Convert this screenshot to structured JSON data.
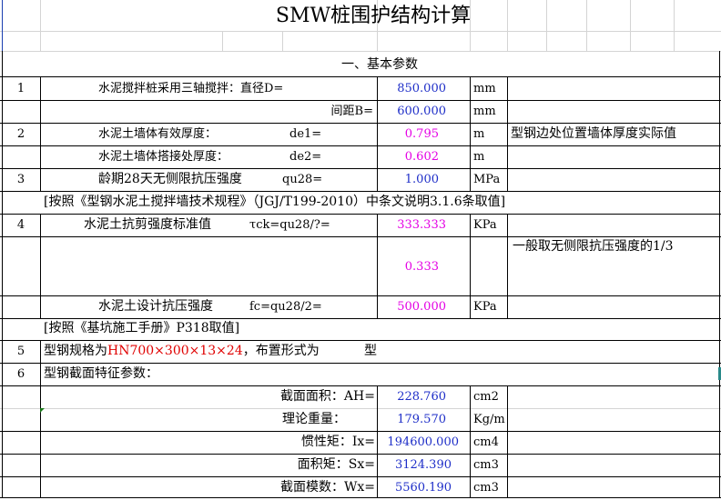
{
  "title": "SMW桩围护结构计算",
  "section1": "一、基本参数",
  "rows": {
    "r1": {
      "no": "1",
      "label": "水泥搅拌桩采用三轴搅拌：直径D=",
      "value": "850.000",
      "unit": "mm"
    },
    "r1b": {
      "label": "间距B=",
      "value": "600.000",
      "unit": "mm"
    },
    "r2": {
      "no": "2",
      "label": "水泥土墙体有效厚度：",
      "sym": "de1=",
      "value": "0.795",
      "unit": "m",
      "note": "型钢边处位置墙体厚度实际值"
    },
    "r2b": {
      "label": "水泥土墙体搭接处厚度：",
      "sym": "de2=",
      "value": "0.602",
      "unit": "m"
    },
    "r3": {
      "no": "3",
      "label": "龄期28天无侧限抗压强度",
      "sym": "qu28=",
      "value": "1.000",
      "unit": "MPa"
    },
    "r3note": "[按照《型钢水泥土搅拌墙技术规程》（JGJ/T199-2010）中条文说明3.1.6条取值]",
    "r4": {
      "no": "4",
      "label": "水泥土抗剪强度标准值",
      "sym": "τck=qu28/?=",
      "value": "333.333",
      "unit": "KPa"
    },
    "r4b": {
      "value": "0.333",
      "note": "一般取无侧限抗压强度的1/3"
    },
    "r4c": {
      "label": "水泥土设计抗压强度",
      "sym": "fc=qu28/2=",
      "value": "500.000",
      "unit": "KPa"
    },
    "r4note": "[按照《基坑施工手册》P318取值]",
    "r5": {
      "no": "5",
      "pre": "型钢规格为",
      "spec": "HN700×300×13×24",
      "post": "，布置形式为",
      "tail": "型"
    },
    "r6": {
      "no": "6",
      "label": "型钢截面特征参数："
    },
    "p1": {
      "label": "截面面积：AH=",
      "value": "228.760",
      "unit": "cm2"
    },
    "p2": {
      "label": "理论重量：",
      "value": "179.570",
      "unit": "Kg/m"
    },
    "p3": {
      "label": "惯性矩：Ix=",
      "value": "194600.000",
      "unit": "cm4"
    },
    "p4": {
      "label": "面积矩：Sx=",
      "value": "3124.390",
      "unit": "cm3"
    },
    "p5": {
      "label": "截面模数：Wx=",
      "value": "5560.190",
      "unit": "cm3"
    }
  },
  "colors": {
    "blue": "#1e2ec8",
    "magenta": "#e400e4",
    "red": "#e00000"
  }
}
